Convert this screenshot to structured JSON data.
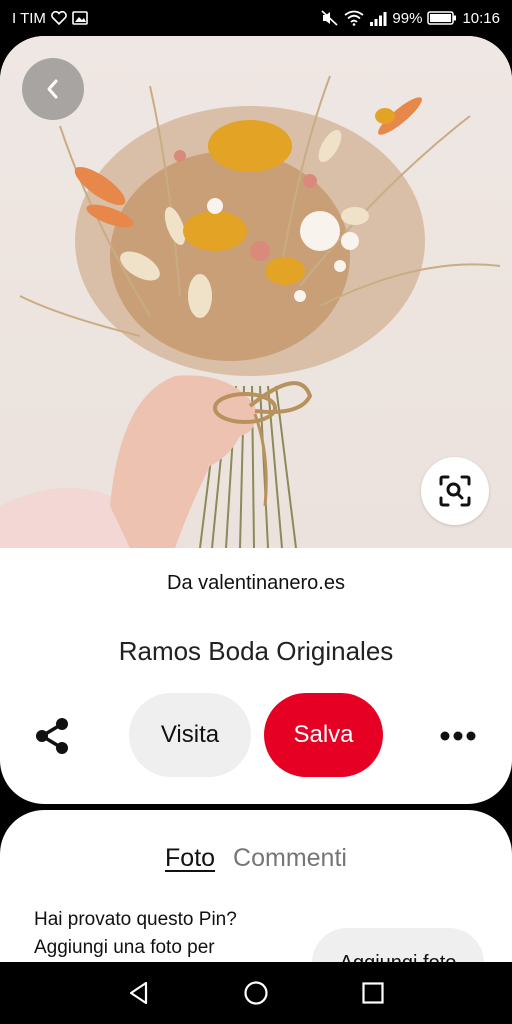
{
  "status_bar": {
    "carrier": "I TIM",
    "battery": "99%",
    "time": "10:16"
  },
  "pin": {
    "source_prefix": "Da",
    "source_domain": "valentinanero.es",
    "title": "Ramos Boda Originales"
  },
  "actions": {
    "visit_label": "Visita",
    "save_label": "Salva"
  },
  "colors": {
    "save_red": "#e60023",
    "pill_gray": "#efefef"
  },
  "tabs": {
    "photo_label": "Foto",
    "comments_label": "Commenti"
  },
  "comments": {
    "prompt_line1": "Hai provato questo Pin?",
    "prompt_line2": "Aggiungi una foto per",
    "add_photo_label": "Aggiungi foto"
  },
  "icons": {
    "back": "chevron-left-icon",
    "lens": "visual-search-icon",
    "share": "share-icon",
    "more": "more-dots-icon"
  }
}
